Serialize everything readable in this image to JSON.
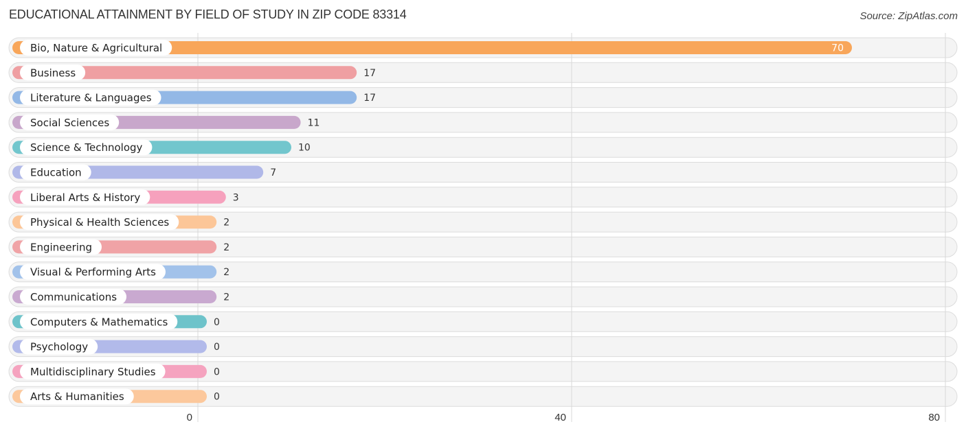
{
  "header": {
    "title": "EDUCATIONAL ATTAINMENT BY FIELD OF STUDY IN ZIP CODE 83314",
    "source": "Source: ZipAtlas.com"
  },
  "chart_data": {
    "type": "bar",
    "orientation": "horizontal",
    "title": "EDUCATIONAL ATTAINMENT BY FIELD OF STUDY IN ZIP CODE 83314",
    "source": "Source: ZipAtlas.com",
    "xlabel": "",
    "ylabel": "",
    "xlim": [
      0,
      80
    ],
    "xticks": [
      0,
      40,
      80
    ],
    "grid": true,
    "legend": "none",
    "categories": [
      "Bio, Nature & Agricultural",
      "Business",
      "Literature & Languages",
      "Social Sciences",
      "Science & Technology",
      "Education",
      "Liberal Arts & History",
      "Physical & Health Sciences",
      "Engineering",
      "Visual & Performing Arts",
      "Communications",
      "Computers & Mathematics",
      "Psychology",
      "Multidisciplinary Studies",
      "Arts & Humanities"
    ],
    "values": [
      70,
      17,
      17,
      11,
      10,
      7,
      3,
      2,
      2,
      2,
      2,
      0,
      0,
      0,
      0
    ],
    "colors": [
      "#f8a65a",
      "#ef9fa2",
      "#93b8e6",
      "#c8a7cb",
      "#72c6cd",
      "#b0b8e8",
      "#f6a1bd",
      "#fcc698",
      "#f0a3a6",
      "#a2c2ea",
      "#c9a9d0",
      "#6ec3ca",
      "#b2baea",
      "#f5a3bf",
      "#fcc89c"
    ]
  }
}
